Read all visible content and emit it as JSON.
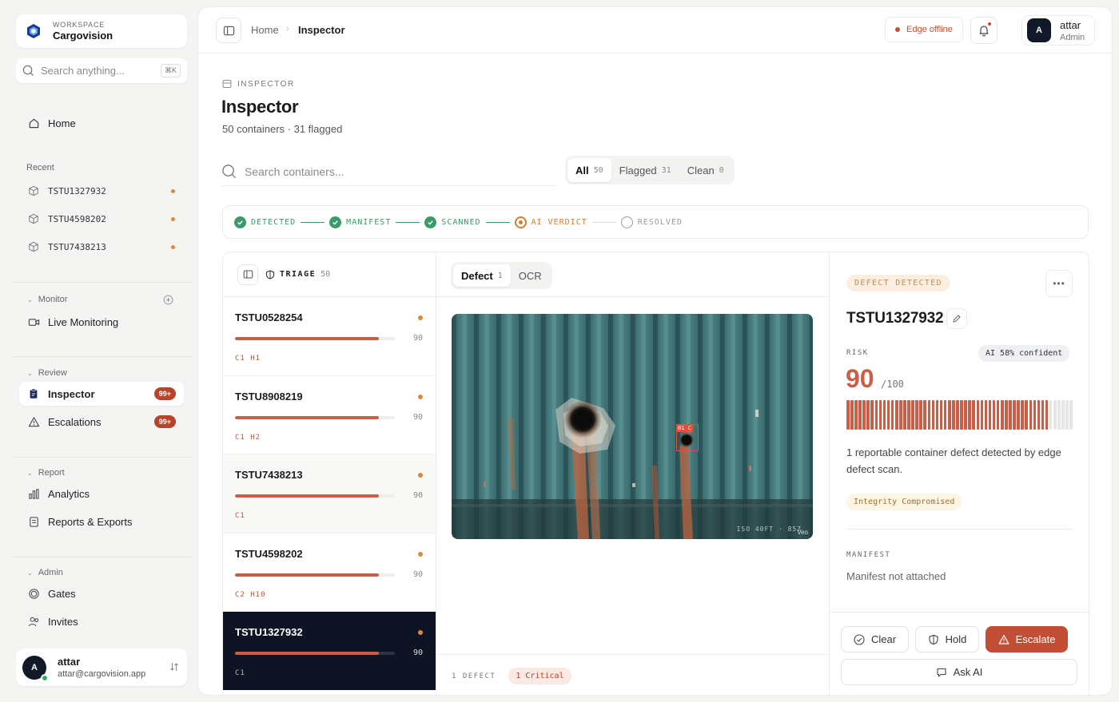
{
  "workspace": {
    "kicker": "WORKSPACE",
    "name": "Cargovision"
  },
  "search": {
    "placeholder": "Search anything...",
    "shortcut": "⌘K"
  },
  "nav": {
    "home": "Home",
    "recent_label": "Recent",
    "recent": [
      "TSTU1327932",
      "TSTU4598202",
      "TSTU7438213"
    ],
    "monitor_label": "Monitor",
    "live_monitoring": "Live Monitoring",
    "review_label": "Review",
    "inspector": "Inspector",
    "inspector_badge": "99+",
    "escalations": "Escalations",
    "escalations_badge": "99+",
    "report_label": "Report",
    "analytics": "Analytics",
    "reports_exports": "Reports & Exports",
    "admin_label": "Admin",
    "gates": "Gates",
    "invites": "Invites"
  },
  "user": {
    "initial": "A",
    "name": "attar",
    "email": "attar@cargovision.app",
    "role": "Admin"
  },
  "breadcrumb": {
    "home": "Home",
    "current": "Inspector"
  },
  "status": {
    "edge": "Edge offline"
  },
  "page": {
    "kicker": "INSPECTOR",
    "title": "Inspector",
    "subtitle": "50 containers · 31 flagged"
  },
  "container_search": {
    "placeholder": "Search containers..."
  },
  "filters": [
    {
      "label": "All",
      "count": "50"
    },
    {
      "label": "Flagged",
      "count": "31"
    },
    {
      "label": "Clean",
      "count": "0"
    }
  ],
  "pipeline": [
    {
      "label": "DETECTED",
      "state": "done"
    },
    {
      "label": "MANIFEST",
      "state": "done"
    },
    {
      "label": "SCANNED",
      "state": "done"
    },
    {
      "label": "AI VERDICT",
      "state": "current"
    },
    {
      "label": "RESOLVED",
      "state": "pending"
    }
  ],
  "triage": {
    "label": "TRIAGE",
    "count": "50",
    "rows": [
      {
        "id": "TSTU0528254",
        "score": "90",
        "progress": 0.9,
        "tags": "C1 H1"
      },
      {
        "id": "TSTU8908219",
        "score": "90",
        "progress": 0.9,
        "tags": "C1 H2"
      },
      {
        "id": "TSTU7438213",
        "score": "90",
        "progress": 0.9,
        "tags": "C1"
      },
      {
        "id": "TSTU4598202",
        "score": "90",
        "progress": 0.9,
        "tags": "C2 H10"
      },
      {
        "id": "TSTU1327932",
        "score": "90",
        "progress": 0.9,
        "tags": "C1"
      }
    ]
  },
  "viewer": {
    "tabs": [
      {
        "label": "Defect",
        "count": "1"
      },
      {
        "label": "OCR",
        "count": ""
      }
    ],
    "detection_label": "01 C",
    "overlay": "ISO 40FT · 857",
    "watermark": "Veo",
    "defect_count_label": "1 DEFECT",
    "critical_badge": "1 Critical"
  },
  "detail": {
    "status_pill": "DEFECT DETECTED",
    "container_id": "TSTU1327932",
    "risk_label": "RISK",
    "confidence": "AI 58% confident",
    "risk_value": "90",
    "risk_max": "/100",
    "risk_fraction": 0.9,
    "description": "1 reportable container defect detected by edge defect scan.",
    "integrity_tag": "Integrity Compromised",
    "manifest_label": "MANIFEST",
    "manifest_value": "Manifest not attached"
  },
  "actions": {
    "clear": "Clear",
    "hold": "Hold",
    "escalate": "Escalate",
    "ask_ai": "Ask AI"
  },
  "colors": {
    "accent": "#c24f35",
    "success": "#3a9a6a",
    "warning": "#d27d2e",
    "dark": "#0f1424"
  }
}
